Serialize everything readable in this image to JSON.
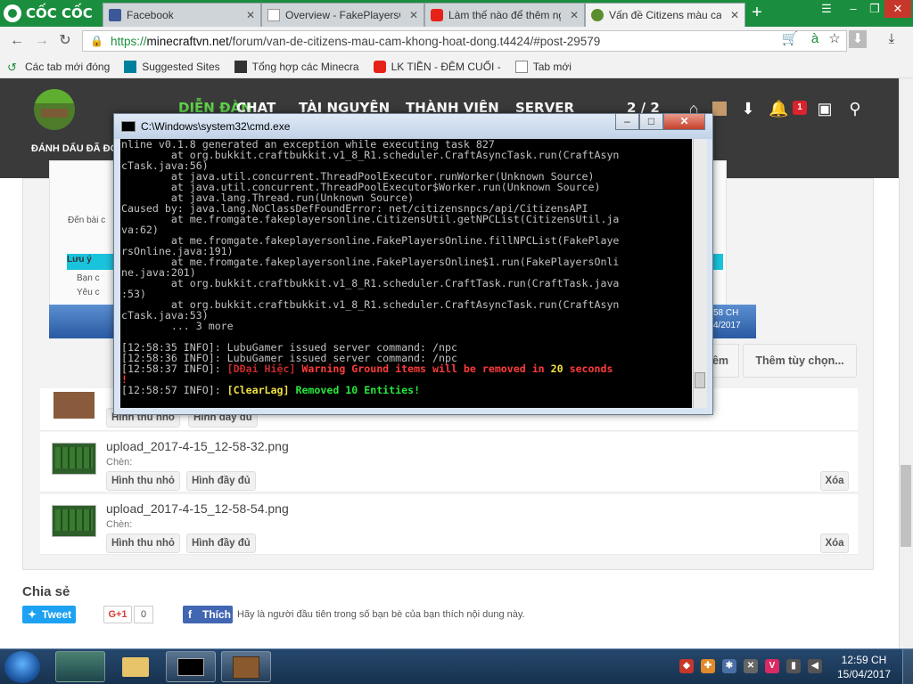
{
  "browser": {
    "brand": "CỐC CỐC",
    "tabs": [
      {
        "label": "Facebook",
        "icon": "facebook-icon",
        "active": false
      },
      {
        "label": "Overview - FakePlayersO",
        "icon": "page-icon",
        "active": false
      },
      {
        "label": "Làm thế nào để thêm ng",
        "icon": "youtube-icon",
        "active": false
      },
      {
        "label": "Vấn đề Citizens màu cam",
        "icon": "minecraft-icon",
        "active": true
      }
    ],
    "url_prefix": "https://",
    "url_domain": "minecraftvn.net",
    "url_path": "/forum/van-de-citizens-mau-cam-khong-hoat-dong.t4424/#post-29579",
    "bookmarks": [
      {
        "label": "Các tab mới đóng",
        "icon": "recent-tabs-icon"
      },
      {
        "label": "Suggested Sites",
        "icon": "bing-icon"
      },
      {
        "label": "Tổng hợp các Minecra",
        "icon": "minecraft-icon"
      },
      {
        "label": "LK TIỀN - ĐÊM CUỐI -",
        "icon": "youtube-icon"
      },
      {
        "label": "Tab mới",
        "icon": "page-icon"
      }
    ],
    "accent": "#1a8e3e"
  },
  "site": {
    "nav": [
      "DIỄN ĐÀN",
      "CHAT",
      "TÀI NGUYÊN",
      "THÀNH VIÊN",
      "SERVER"
    ],
    "pager": "2 / 2",
    "mark_read": "ĐÁNH DẤU ĐÃ ĐỌC",
    "notif_count": "1",
    "mini_warning": "Lưu ý",
    "mini_line1": "Bạn c",
    "mini_line2": "Yêu c",
    "mini_den": "Đến bài c",
    "mini_clock1": "58 CH",
    "mini_clock2": "4/2017"
  },
  "uploads": [
    {
      "name": "upload_2017-4-15_12-58-32.png",
      "insert": "Chèn:",
      "thumb": "Hình thu nhỏ",
      "full": "Hình đầy đủ",
      "delete": "Xóa"
    },
    {
      "name": "upload_2017-4-15_12-58-54.png",
      "insert": "Chèn:",
      "thumb": "Hình thu nhỏ",
      "full": "Hình đầy đủ",
      "delete": "Xóa"
    }
  ],
  "partial_row": {
    "thumb": "Hình thu nhỏ",
    "full": "Hình đầy đủ"
  },
  "buttons": {
    "partial": "êm",
    "more_options": "Thêm tùy chọn..."
  },
  "share": {
    "title": "Chia sẻ",
    "tweet": "Tweet",
    "gplus": "G+1",
    "gcount": "0",
    "fb_like": "Thích",
    "fb_text": "Hãy là người đầu tiên trong số bạn bè của bạn thích nội dung này."
  },
  "cmd": {
    "title": "C:\\Windows\\system32\\cmd.exe",
    "lines": [
      "nline v0.1.8 generated an exception while executing task 827",
      "        at org.bukkit.craftbukkit.v1_8_R1.scheduler.CraftAsyncTask.run(CraftAsyn",
      "cTask.java:56)",
      "        at java.util.concurrent.ThreadPoolExecutor.runWorker(Unknown Source)",
      "        at java.util.concurrent.ThreadPoolExecutor$Worker.run(Unknown Source)",
      "        at java.lang.Thread.run(Unknown Source)",
      "Caused by: java.lang.NoClassDefFoundError: net/citizensnpcs/api/CitizensAPI",
      "        at me.fromgate.fakeplayersonline.CitizensUtil.getNPCList(CitizensUtil.ja",
      "va:62)",
      "        at me.fromgate.fakeplayersonline.FakePlayersOnline.fillNPCList(FakePlaye",
      "rsOnline.java:191)",
      "        at me.fromgate.fakeplayersonline.FakePlayersOnline$1.run(FakePlayersOnli",
      "ne.java:201)",
      "        at org.bukkit.craftbukkit.v1_8_R1.scheduler.CraftTask.run(CraftTask.java",
      ":53)",
      "        at org.bukkit.craftbukkit.v1_8_R1.scheduler.CraftAsyncTask.run(CraftAsyn",
      "cTask.java:53)",
      "        ... 3 more",
      "",
      "[12:58:35 INFO]: LubuGamer issued server command: /npc",
      "[12:58:36 INFO]: LubuGamer issued server command: /npc"
    ],
    "line_warn_prefix": "[12:58:37 INFO]: ",
    "line_warn_tag": "[DĐại Hiệc]",
    "line_warn_msg": " Warning Ground items will be removed in ",
    "line_warn_num": "20",
    "line_warn_end": " seconds",
    "line_warn_cont": "!",
    "line_clear_prefix": "[12:58:57 INFO]: ",
    "line_clear_tag": "[ClearLag]",
    "line_clear_msg": " Removed 10 Entities!",
    "prompt": ">_"
  },
  "taskbar": {
    "time": "12:59 CH",
    "date": "15/04/2017"
  }
}
